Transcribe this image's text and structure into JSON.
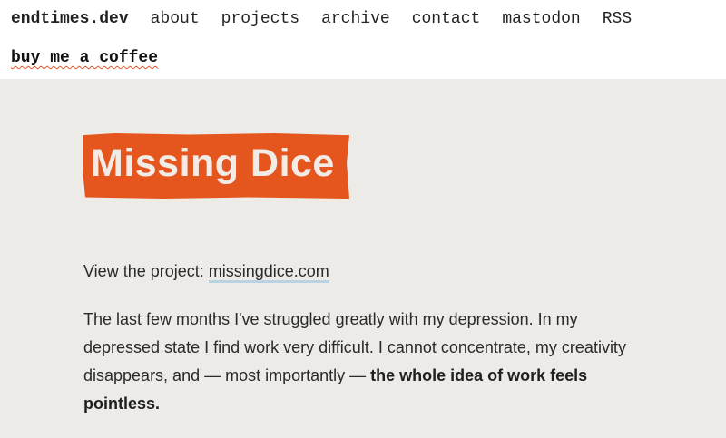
{
  "nav": {
    "site_name": "endtimes.dev",
    "links": [
      "about",
      "projects",
      "archive",
      "contact",
      "mastodon",
      "RSS"
    ],
    "coffee_label": "buy me a coffee"
  },
  "logo": {
    "text": "Missing Dice"
  },
  "article": {
    "project_prefix": "View the project: ",
    "project_link": "missingdice.com",
    "para_text": "The last few months I've struggled greatly with my depression. In my depressed state I find work very difficult. I cannot concentrate, my creativity disappears, and — most importantly — ",
    "para_bold": "the whole idea of work feels pointless."
  },
  "colors": {
    "logo_bg": "#e5561f",
    "page_bg": "#edebe7",
    "link_underline": "#b9d3e3",
    "wavy_underline": "#e05a2a"
  }
}
